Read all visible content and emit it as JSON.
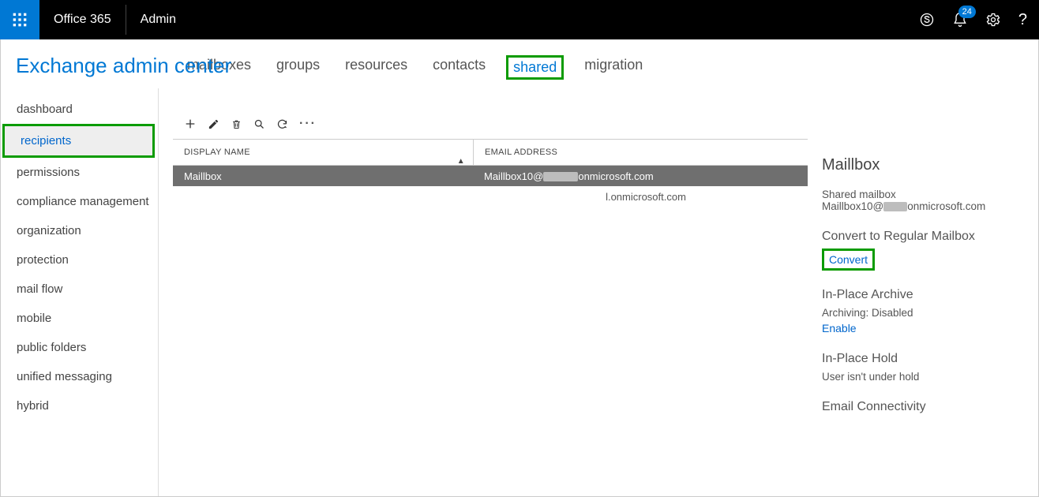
{
  "top": {
    "brand": "Office 365",
    "app": "Admin",
    "notif_count": "24"
  },
  "page_title": "Exchange admin center",
  "nav": {
    "items": [
      {
        "label": "dashboard"
      },
      {
        "label": "recipients"
      },
      {
        "label": "permissions"
      },
      {
        "label": "compliance management"
      },
      {
        "label": "organization"
      },
      {
        "label": "protection"
      },
      {
        "label": "mail flow"
      },
      {
        "label": "mobile"
      },
      {
        "label": "public folders"
      },
      {
        "label": "unified messaging"
      },
      {
        "label": "hybrid"
      }
    ],
    "active_index": 1
  },
  "tabs": {
    "items": [
      "mailboxes",
      "groups",
      "resources",
      "contacts",
      "shared",
      "migration"
    ],
    "active_index": 4
  },
  "grid": {
    "columns": {
      "name": "DISPLAY NAME",
      "email": "EMAIL ADDRESS"
    },
    "sort_asc": "▲",
    "rows": [
      {
        "name": "Maillbox",
        "email_pre": "Maillbox10@",
        "email_post": "onmicrosoft.com",
        "selected": true
      },
      {
        "name": "",
        "email_pre": "",
        "email_post": "l.onmicrosoft.com",
        "selected": false
      }
    ]
  },
  "details": {
    "title": "Maillbox",
    "type": "Shared mailbox",
    "email_pre": "Maillbox10@",
    "email_post": "onmicrosoft.com",
    "convert_h": "Convert to Regular Mailbox",
    "convert_link": "Convert",
    "archive_h": "In-Place Archive",
    "archive_t": "Archiving:  Disabled",
    "archive_link": "Enable",
    "hold_h": "In-Place Hold",
    "hold_t": "User isn't under hold",
    "conn_h": "Email Connectivity"
  }
}
